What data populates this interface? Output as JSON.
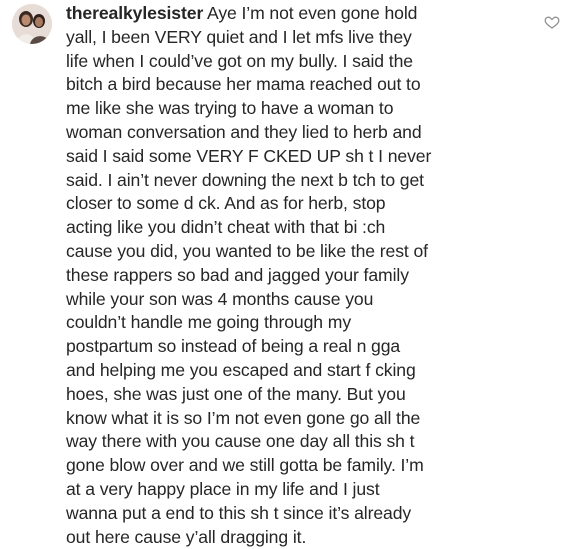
{
  "comment": {
    "username": "therealkylesister",
    "first_line_text": " Aye I’m not even gone hold",
    "lines": [
      "yall, I been VERY quiet and I let mfs live they",
      "life when I could’ve got on my bully. I said the",
      "bitch a bird because her mama reached out to",
      "me like she was trying to have a woman to",
      "woman conversation and they lied to herb and",
      "said I said some VERY F  CKED UP sh t I never",
      "said. I ain’t never downing the next b tch to get",
      "closer to some d ck. And as for herb, stop",
      "acting like you didn’t cheat with that bi :ch",
      "cause you did, you wanted to be like the rest of",
      "these rappers so bad and jagged your family",
      "while your son was 4 months cause you",
      "couldn’t handle me going through my",
      "postpartum so instead of being a real n gga",
      "and helping me you escaped and start f  cking",
      "hoes, she was just one of the many. But you",
      "know what it is so I’m not even gone go all the",
      "way there with you cause one day all this sh t",
      "gone blow over and we still gotta be family. I’m",
      "at a very happy place in my life and I just",
      "wanna put a end to this sh t since it’s already",
      "out here cause y’all dragging it."
    ],
    "avatar_icon": "profile-avatar",
    "like_icon": "heart-outline-icon"
  },
  "colors": {
    "text": "#262626",
    "icon": "#8e8e8e",
    "background": "#ffffff"
  }
}
